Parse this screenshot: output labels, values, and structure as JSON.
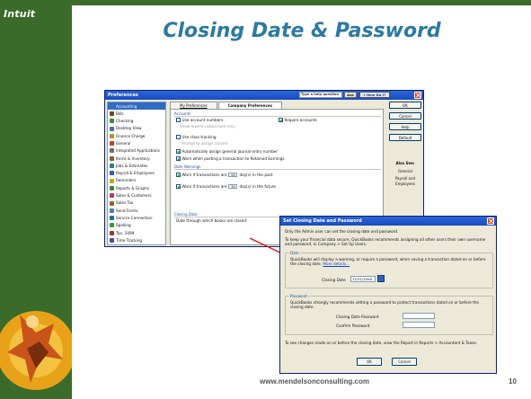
{
  "slide": {
    "logo": "Intuit",
    "title": "Closing Date & Password",
    "footer": "www.mendelsonconsulting.com",
    "page_number": "10",
    "brand_color": "#3b6b2a",
    "title_color": "#2d7aa0"
  },
  "prefs": {
    "title": "Preferences",
    "help_placeholder": "Type a help question",
    "ask": "Ask",
    "how_do_i": "How Do I?",
    "list": [
      {
        "label": "Accounting",
        "icon": "accounting-icon",
        "color": "#2f6fd0",
        "selected": true
      },
      {
        "label": "Bills",
        "icon": "bills-icon",
        "color": "#6b4a1d"
      },
      {
        "label": "Checking",
        "icon": "checking-icon",
        "color": "#3c8c3a"
      },
      {
        "label": "Desktop View",
        "icon": "desktop-view-icon",
        "color": "#4a6fa8"
      },
      {
        "label": "Finance Charge",
        "icon": "finance-charge-icon",
        "color": "#b8902a"
      },
      {
        "label": "General",
        "icon": "general-icon",
        "color": "#c93a2a"
      },
      {
        "label": "Integrated Applications",
        "icon": "integrated-apps-icon",
        "color": "#6d6d6d"
      },
      {
        "label": "Items & Inventory",
        "icon": "items-inventory-icon",
        "color": "#8a5b2a"
      },
      {
        "label": "Jobs & Estimates",
        "icon": "jobs-estimates-icon",
        "color": "#2a7f8c"
      },
      {
        "label": "Payroll & Employees",
        "icon": "payroll-icon",
        "color": "#2a5fc0"
      },
      {
        "label": "Reminders",
        "icon": "reminders-icon",
        "color": "#d0a020"
      },
      {
        "label": "Reports & Graphs",
        "icon": "reports-graphs-icon",
        "color": "#3a8a3a"
      },
      {
        "label": "Sales & Customers",
        "icon": "sales-customers-icon",
        "color": "#b03a60"
      },
      {
        "label": "Sales Tax",
        "icon": "sales-tax-icon",
        "color": "#8a6a2a"
      },
      {
        "label": "Send Forms",
        "icon": "send-forms-icon",
        "color": "#4a7ab0"
      },
      {
        "label": "Service Connection",
        "icon": "service-connection-icon",
        "color": "#2a6a9a"
      },
      {
        "label": "Spelling",
        "icon": "spelling-icon",
        "color": "#3a9a3a"
      },
      {
        "label": "Tax: 1099",
        "icon": "tax-1099-icon",
        "color": "#9a3a2a"
      },
      {
        "label": "Time Tracking",
        "icon": "time-tracking-icon",
        "color": "#4a4aa0"
      }
    ],
    "tabs": [
      "My Preferences",
      "Company Preferences"
    ],
    "accounts_label": "Accounts",
    "use_account_numbers": "Use account numbers",
    "show_lowest": "Show lowest subaccount only",
    "require_accounts": "Require accounts",
    "use_class_tracking": "Use class tracking",
    "prompt_classes": "Prompt to assign classes",
    "auto_journal": "Automatically assign general journal entry number",
    "warn_retained": "Warn when posting a transaction to Retained Earnings",
    "date_warnings_label": "Date Warnings",
    "warn_past_a": "Warn if transactions are",
    "warn_past_days": "90",
    "warn_past_b": "day(s) in the past",
    "warn_future_a": "Warn if transactions are",
    "warn_future_days": "30",
    "warn_future_b": "day(s) in the future",
    "closing_date_label": "Closing Date",
    "closing_date_text": "Date through which books are closed:",
    "closing_date_partial": "12/31",
    "set_date_password": "Set Date/Password",
    "buttons": [
      "OK",
      "Cancel",
      "Help",
      "Default"
    ],
    "also_see": "Also See:",
    "also_see_links": [
      "General",
      "Payroll and Employees"
    ]
  },
  "dialog": {
    "title": "Set Closing Date and Password",
    "admin_note": "Only the Admin user can set the closing date and password.",
    "intro": "To keep your financial data secure, QuickBooks recommends assigning all other users their own username and password, in Company > Set Up Users.",
    "date_label": "Date",
    "date_text": "QuickBooks will display a warning, or require a password, when saving a transaction dated on or before the closing date.",
    "more_details": "More details...",
    "closing_date_field_label": "Closing Date",
    "closing_date_value": "12/31/2008",
    "password_label": "Password",
    "password_text": "QuickBooks strongly recommends setting a password to protect transactions dated on or before the closing date.",
    "closing_pwd_label": "Closing Date Password",
    "confirm_pwd_label": "Confirm Password",
    "footer_text": "To see changes made on or before the closing date, view the Report in Reports > Accountant & Taxes.",
    "ok": "OK",
    "cancel": "Cancel"
  }
}
